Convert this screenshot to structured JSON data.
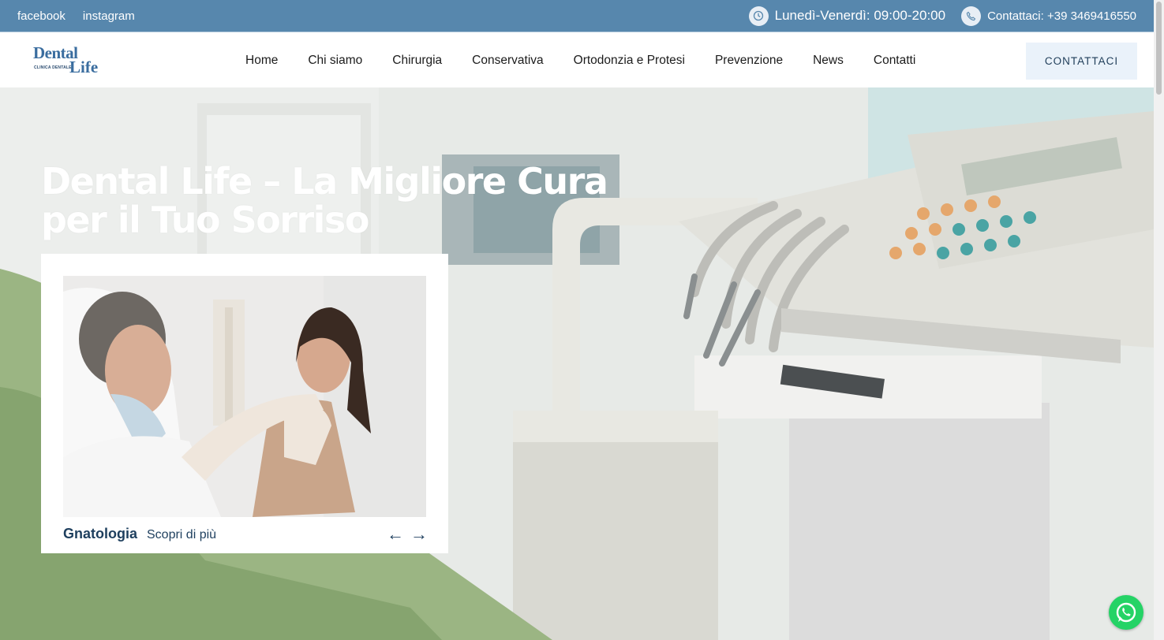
{
  "topbar": {
    "social": [
      "facebook",
      "instagram"
    ],
    "hours": "Lunedì-Venerdì: 09:00-20:00",
    "phone": "Contattaci: +39 3469416550"
  },
  "header": {
    "logo": {
      "line1": "Dental",
      "line2": "Life",
      "tagline": "CLINICA DENTALE"
    },
    "nav": [
      "Home",
      "Chi siamo",
      "Chirurgia",
      "Conservativa",
      "Ortodonzia e Protesi",
      "Prevenzione",
      "News",
      "Contatti"
    ],
    "cta": "CONTATTACI"
  },
  "hero": {
    "title": "Dental Life – La Migliore Cura per il Tuo Sorriso",
    "card": {
      "title": "Gnatologia",
      "link": "Scopri di più",
      "prev": "←",
      "next": "→"
    }
  },
  "colors": {
    "topbar": "#5787ad",
    "accent": "#1e3f5e",
    "cta_bg": "#eaf2fa"
  },
  "icons": {
    "hours": "clock-icon",
    "phone": "phone-icon",
    "whatsapp": "whatsapp-icon"
  }
}
